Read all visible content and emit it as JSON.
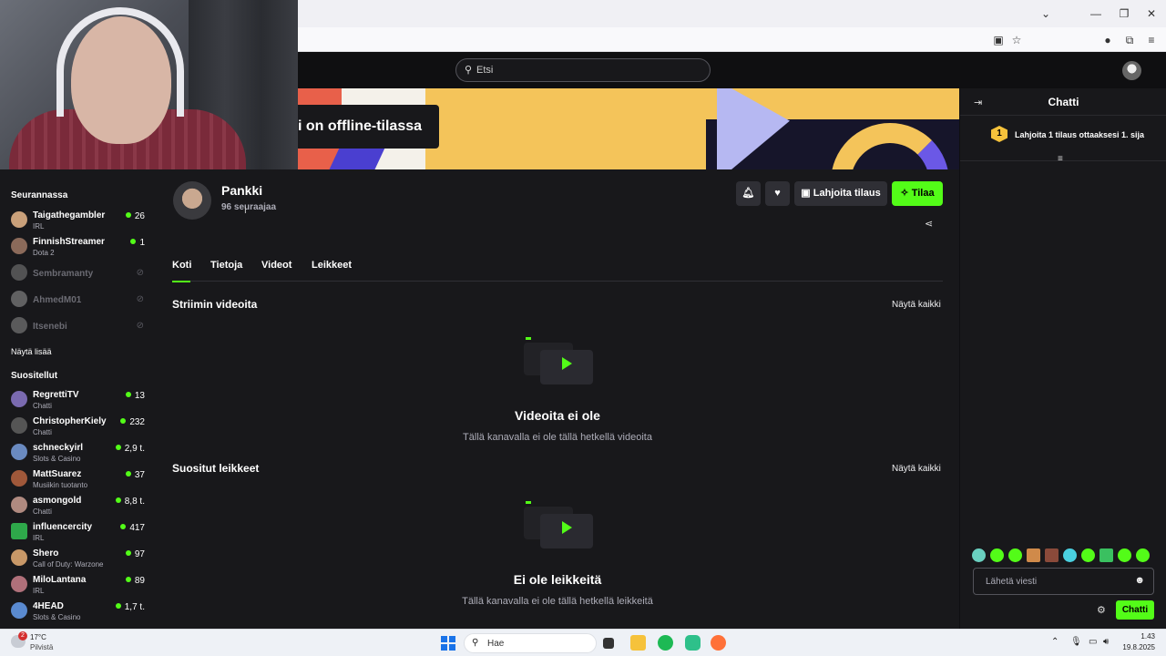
{
  "browser": {
    "window_buttons": {
      "dropdown": "⌄",
      "minimize": "—",
      "maximize": "❐",
      "close": "✕"
    }
  },
  "topnav": {
    "search_placeholder": "Etsi"
  },
  "banner": {
    "offline_text": "i on offline-tilassa"
  },
  "sidebar": {
    "following_title": "Seurannassa",
    "following": [
      {
        "name": "Taigathegambler",
        "category": "IRL",
        "viewers": "26",
        "live": true
      },
      {
        "name": "FinnishStreamer",
        "category": "Dota 2",
        "viewers": "1",
        "live": true
      },
      {
        "name": "Sembramanty",
        "live": false
      },
      {
        "name": "AhmedM01",
        "live": false
      },
      {
        "name": "Itsenebi",
        "live": false
      }
    ],
    "show_more": "Näytä lisää",
    "recommended_title": "Suositellut",
    "recommended": [
      {
        "name": "RegrettiTV",
        "category": "Chatti",
        "viewers": "13"
      },
      {
        "name": "ChristopherKiely",
        "category": "Chatti",
        "viewers": "232"
      },
      {
        "name": "schneckyirl",
        "category": "Slots & Casino",
        "viewers": "2,9 t."
      },
      {
        "name": "MattSuarez",
        "category": "Musiikin tuotanto",
        "viewers": "37"
      },
      {
        "name": "asmongold",
        "category": "Chatti",
        "viewers": "8,8 t."
      },
      {
        "name": "influencercity",
        "category": "IRL",
        "viewers": "417"
      },
      {
        "name": "Shero",
        "category": "Call of Duty: Warzone",
        "viewers": "97"
      },
      {
        "name": "MiloLantana",
        "category": "IRL",
        "viewers": "89"
      },
      {
        "name": "4HEAD",
        "category": "Slots & Casino",
        "viewers": "1,7 t."
      }
    ]
  },
  "channel": {
    "name": "Pankki",
    "followers": "96 seuraajaa",
    "gift_label": "Lahjoita tilaus",
    "subscribe_label": "Tilaa",
    "gift_icon": "gift-icon",
    "subscribe_icon": "sparkle-icon"
  },
  "tabs": [
    {
      "label": "Koti",
      "active": true
    },
    {
      "label": "Tietoja",
      "active": false
    },
    {
      "label": "Videot",
      "active": false
    },
    {
      "label": "Leikkeet",
      "active": false
    }
  ],
  "sections": {
    "videos": {
      "title": "Striimin videoita",
      "show_all": "Näytä kaikki",
      "empty_title": "Videoita ei ole",
      "empty_sub": "Tällä kanavalla ei ole tällä hetkellä videoita"
    },
    "clips": {
      "title": "Suositut leikkeet",
      "show_all": "Näytä kaikki",
      "empty_title": "Ei ole leikkeitä",
      "empty_sub": "Tällä kanavalla ei ole tällä hetkellä leikkeitä"
    }
  },
  "chat": {
    "title": "Chatti",
    "goal_rank": "1",
    "goal_text": "Lahjoita 1 tilaus ottaaksesi 1. sija",
    "input_placeholder": "Lähetä viesti",
    "send_label": "Chatti"
  },
  "taskbar": {
    "weather_badge": "2",
    "weather_temp": "17°C",
    "weather_desc": "Pilvistä",
    "search_label": "Hae",
    "time": "1.43",
    "date": "19.8.2025"
  },
  "colors": {
    "accent": "#53fc18",
    "background": "#18181b",
    "topnav": "#0f0f11",
    "button": "#2f2f35",
    "muted_text": "#adadb8",
    "goal_badge": "#f6c23b"
  }
}
